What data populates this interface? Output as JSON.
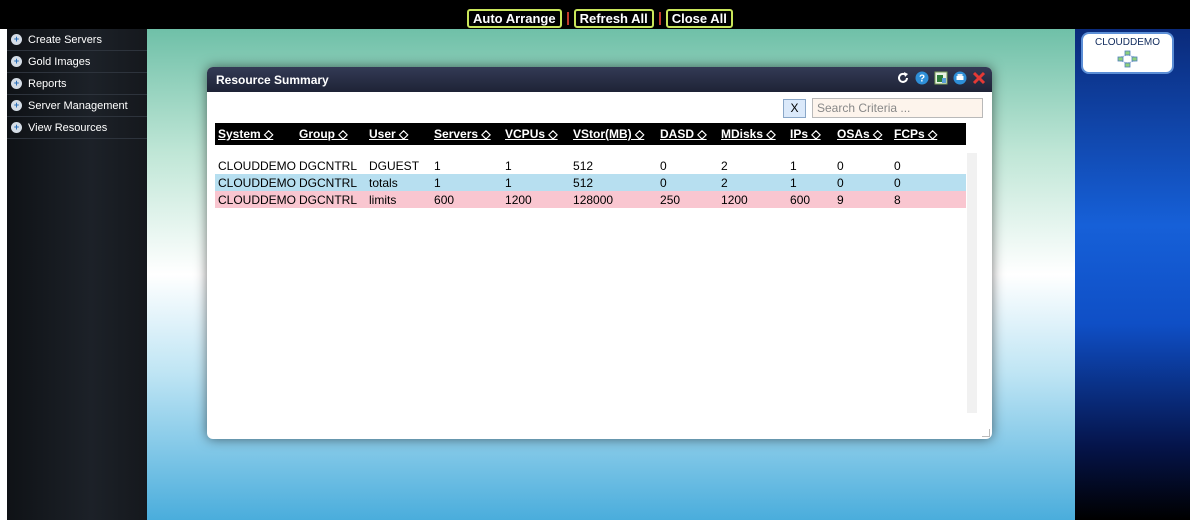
{
  "topbar": {
    "buttons": [
      "Auto Arrange",
      "Refresh All",
      "Close All"
    ]
  },
  "sidebar": {
    "items": [
      {
        "label": "Create Servers",
        "icon": "plus-circle-icon"
      },
      {
        "label": "Gold Images",
        "icon": "plus-circle-icon"
      },
      {
        "label": "Reports",
        "icon": "plus-circle-icon"
      },
      {
        "label": "Server Management",
        "icon": "plus-circle-icon"
      },
      {
        "label": "View Resources",
        "icon": "plus-circle-icon"
      }
    ]
  },
  "rightpanel": {
    "system_label": "CLOUDDEMO",
    "system_icon": "network-icon"
  },
  "dialog": {
    "title": "Resource Summary",
    "title_icons": [
      "refresh-icon",
      "help-icon",
      "export-excel-icon",
      "print-icon",
      "close-icon"
    ],
    "clear_label": "X",
    "search_placeholder": "Search Criteria ...",
    "columns": [
      "System ◇",
      "Group ◇",
      "User ◇",
      "Servers ◇",
      "VCPUs ◇",
      "VStor(MB) ◇",
      "DASD ◇",
      "MDisks ◇",
      "IPs ◇",
      "OSAs ◇",
      "FCPs ◇"
    ],
    "rows": [
      {
        "type": "data",
        "cells": [
          "CLOUDDEMO",
          "DGCNTRL",
          "DGUEST",
          "1",
          "1",
          "512",
          "0",
          "2",
          "1",
          "0",
          "0"
        ]
      },
      {
        "type": "totals",
        "cells": [
          "CLOUDDEMO",
          "DGCNTRL",
          "totals",
          "1",
          "1",
          "512",
          "0",
          "2",
          "1",
          "0",
          "0"
        ]
      },
      {
        "type": "limits",
        "cells": [
          "CLOUDDEMO",
          "DGCNTRL",
          "limits",
          "600",
          "1200",
          "128000",
          "250",
          "1200",
          "600",
          "9",
          "8"
        ]
      }
    ]
  },
  "colors": {
    "totals_row": "#b7dff0",
    "limits_row": "#f9c6d0",
    "topbar_button_border": "#c9e65a",
    "topbar_separator": "#c0392b"
  }
}
